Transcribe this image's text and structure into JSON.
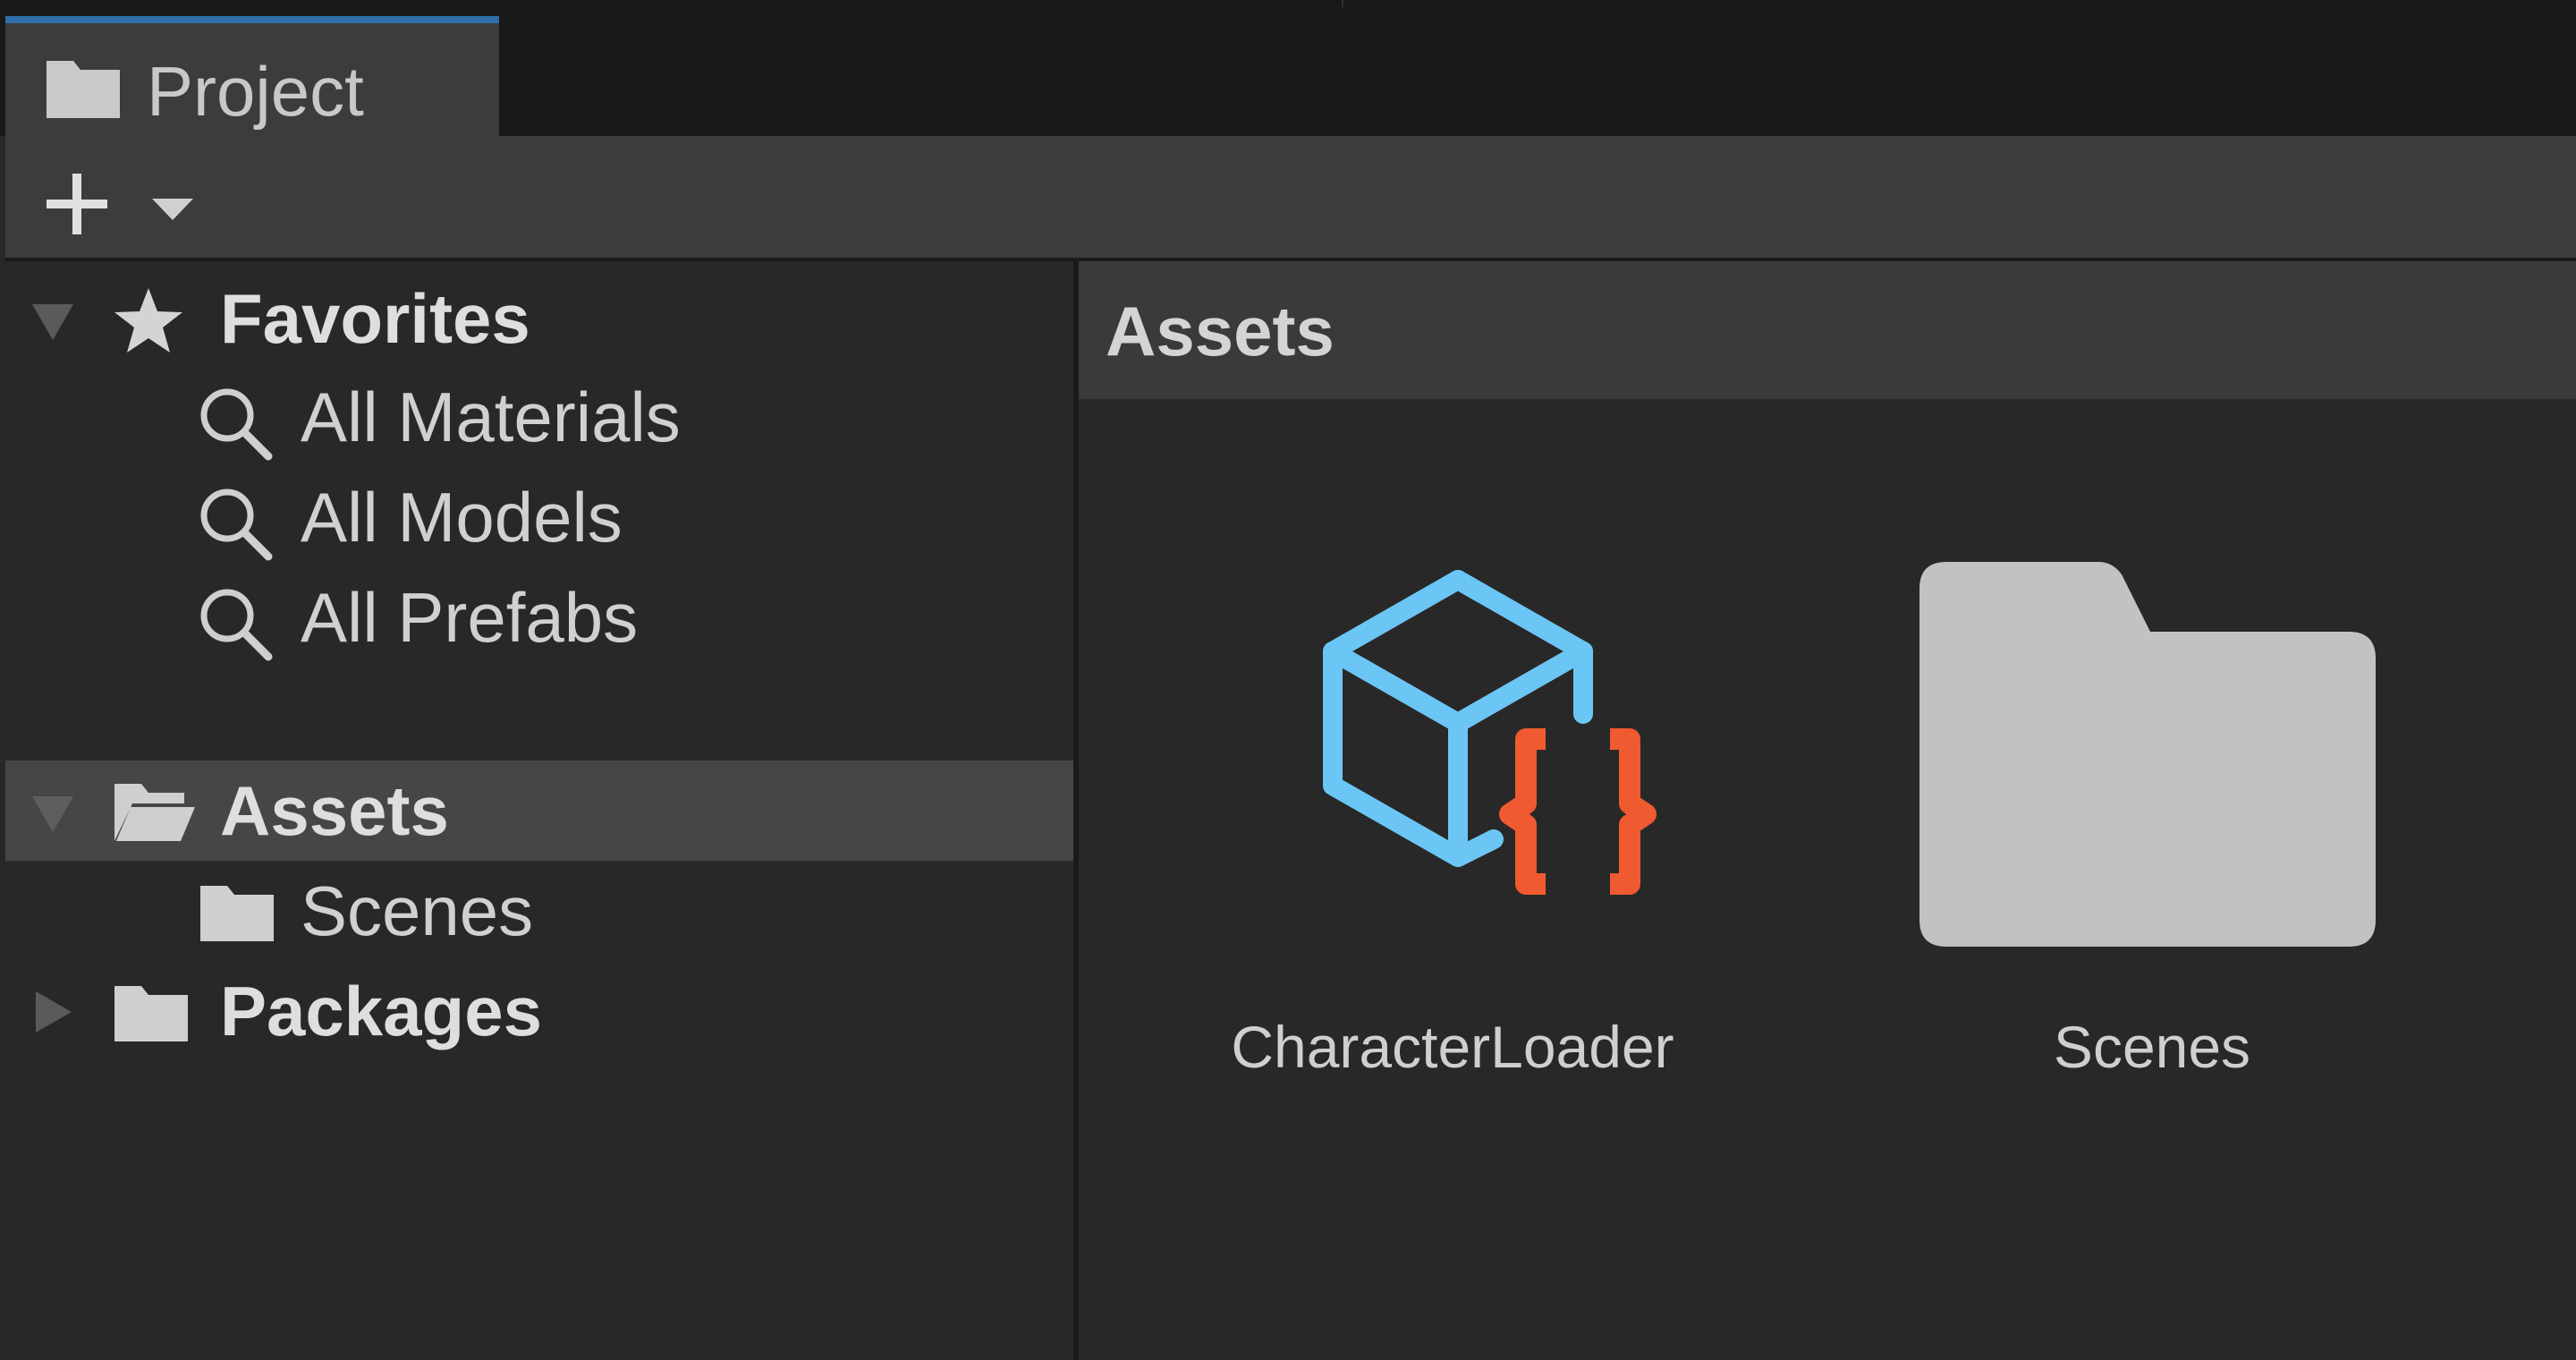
{
  "tab": {
    "title": "Project"
  },
  "toolbar": {
    "add_label": "+",
    "add_icon": "plus-icon",
    "menu_icon": "caret-down-icon"
  },
  "tree": {
    "favorites": {
      "label": "Favorites",
      "icon": "star-icon",
      "items": [
        {
          "label": "All Materials",
          "icon": "search-icon"
        },
        {
          "label": "All Models",
          "icon": "search-icon"
        },
        {
          "label": "All Prefabs",
          "icon": "search-icon"
        }
      ]
    },
    "assets": {
      "label": "Assets",
      "icon": "folder-open-icon",
      "selected": true,
      "children": [
        {
          "label": "Scenes",
          "icon": "folder-icon"
        }
      ]
    },
    "packages": {
      "label": "Packages",
      "icon": "folder-icon"
    }
  },
  "content": {
    "breadcrumb": "Assets",
    "items": [
      {
        "label": "CharacterLoader",
        "icon": "csharp-script-icon"
      },
      {
        "label": "Scenes",
        "icon": "folder-icon"
      }
    ]
  },
  "colors": {
    "script_cube": "#6cc6f5",
    "script_braces": "#f05a30",
    "folder": "#c2c2c2",
    "selected_row": "#464646"
  }
}
